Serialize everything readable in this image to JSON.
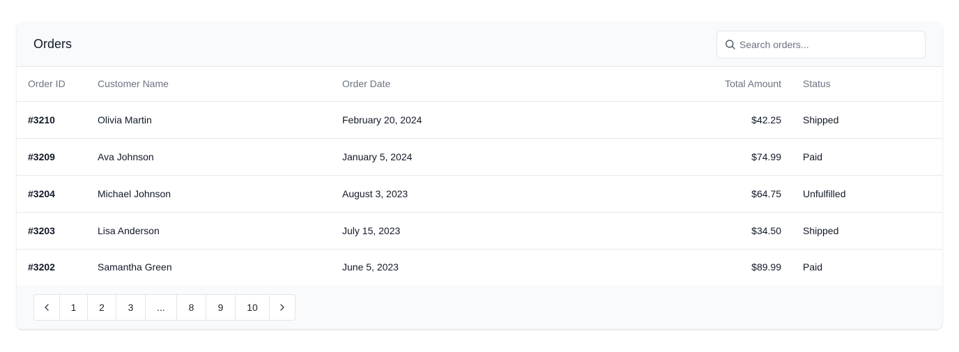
{
  "header": {
    "title": "Orders",
    "search": {
      "placeholder": "Search orders...",
      "value": ""
    }
  },
  "table": {
    "columns": [
      "Order ID",
      "Customer Name",
      "Order Date",
      "Total Amount",
      "Status"
    ],
    "rows": [
      {
        "id": "#3210",
        "customer": "Olivia Martin",
        "date": "February 20, 2024",
        "amount": "$42.25",
        "status": "Shipped"
      },
      {
        "id": "#3209",
        "customer": "Ava Johnson",
        "date": "January 5, 2024",
        "amount": "$74.99",
        "status": "Paid"
      },
      {
        "id": "#3204",
        "customer": "Michael Johnson",
        "date": "August 3, 2023",
        "amount": "$64.75",
        "status": "Unfulfilled"
      },
      {
        "id": "#3203",
        "customer": "Lisa Anderson",
        "date": "July 15, 2023",
        "amount": "$34.50",
        "status": "Shipped"
      },
      {
        "id": "#3202",
        "customer": "Samantha Green",
        "date": "June 5, 2023",
        "amount": "$89.99",
        "status": "Paid"
      }
    ]
  },
  "pagination": {
    "pages": [
      "1",
      "2",
      "3",
      "...",
      "8",
      "9",
      "10"
    ],
    "prev_icon": "chevron-left-icon",
    "next_icon": "chevron-right-icon"
  },
  "icons": {
    "search": "search-icon"
  },
  "colors": {
    "header_bg": "#f8fafc",
    "border": "#e5e7eb",
    "muted_text": "#6b7280",
    "text": "#111827"
  }
}
